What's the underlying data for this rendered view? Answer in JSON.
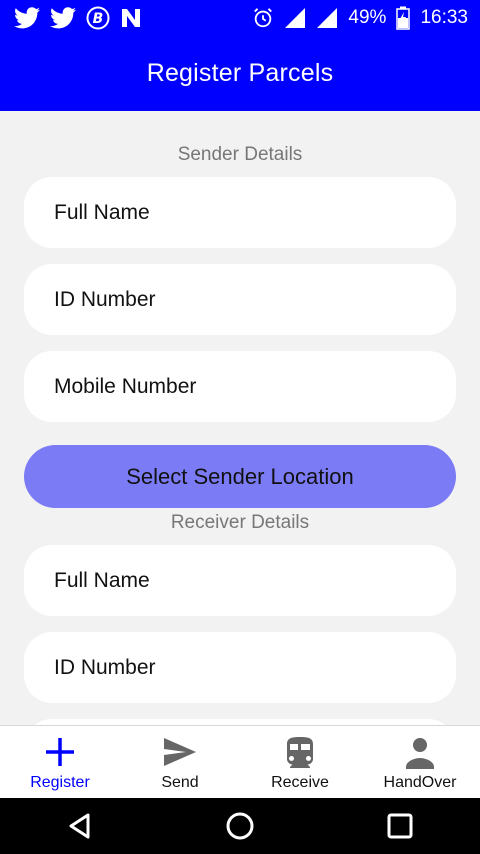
{
  "status_bar": {
    "battery": "49%",
    "time": "16:33",
    "icons": [
      "twitter-icon",
      "twitter-icon",
      "bitcoin-icon",
      "n-icon",
      "alarm-icon",
      "signal-icon",
      "signal-icon",
      "battery-charging-icon"
    ]
  },
  "app_bar": {
    "title": "Register Parcels",
    "color": "#0000ff"
  },
  "sender": {
    "heading": "Sender Details",
    "full_name_placeholder": "Full Name",
    "id_placeholder": "ID Number",
    "mobile_placeholder": "Mobile Number",
    "location_button": "Select Sender Location"
  },
  "receiver": {
    "heading": "Receiver Details",
    "full_name_placeholder": "Full Name",
    "id_placeholder": "ID Number"
  },
  "bottom_nav": {
    "items": [
      {
        "label": "Register",
        "icon": "plus-icon",
        "active": true
      },
      {
        "label": "Send",
        "icon": "send-icon",
        "active": false
      },
      {
        "label": "Receive",
        "icon": "train-icon",
        "active": false
      },
      {
        "label": "HandOver",
        "icon": "person-icon",
        "active": false
      }
    ],
    "active_color": "#0000ff"
  },
  "colors": {
    "button": "#7b7bf6",
    "background": "#f2f2f2"
  }
}
